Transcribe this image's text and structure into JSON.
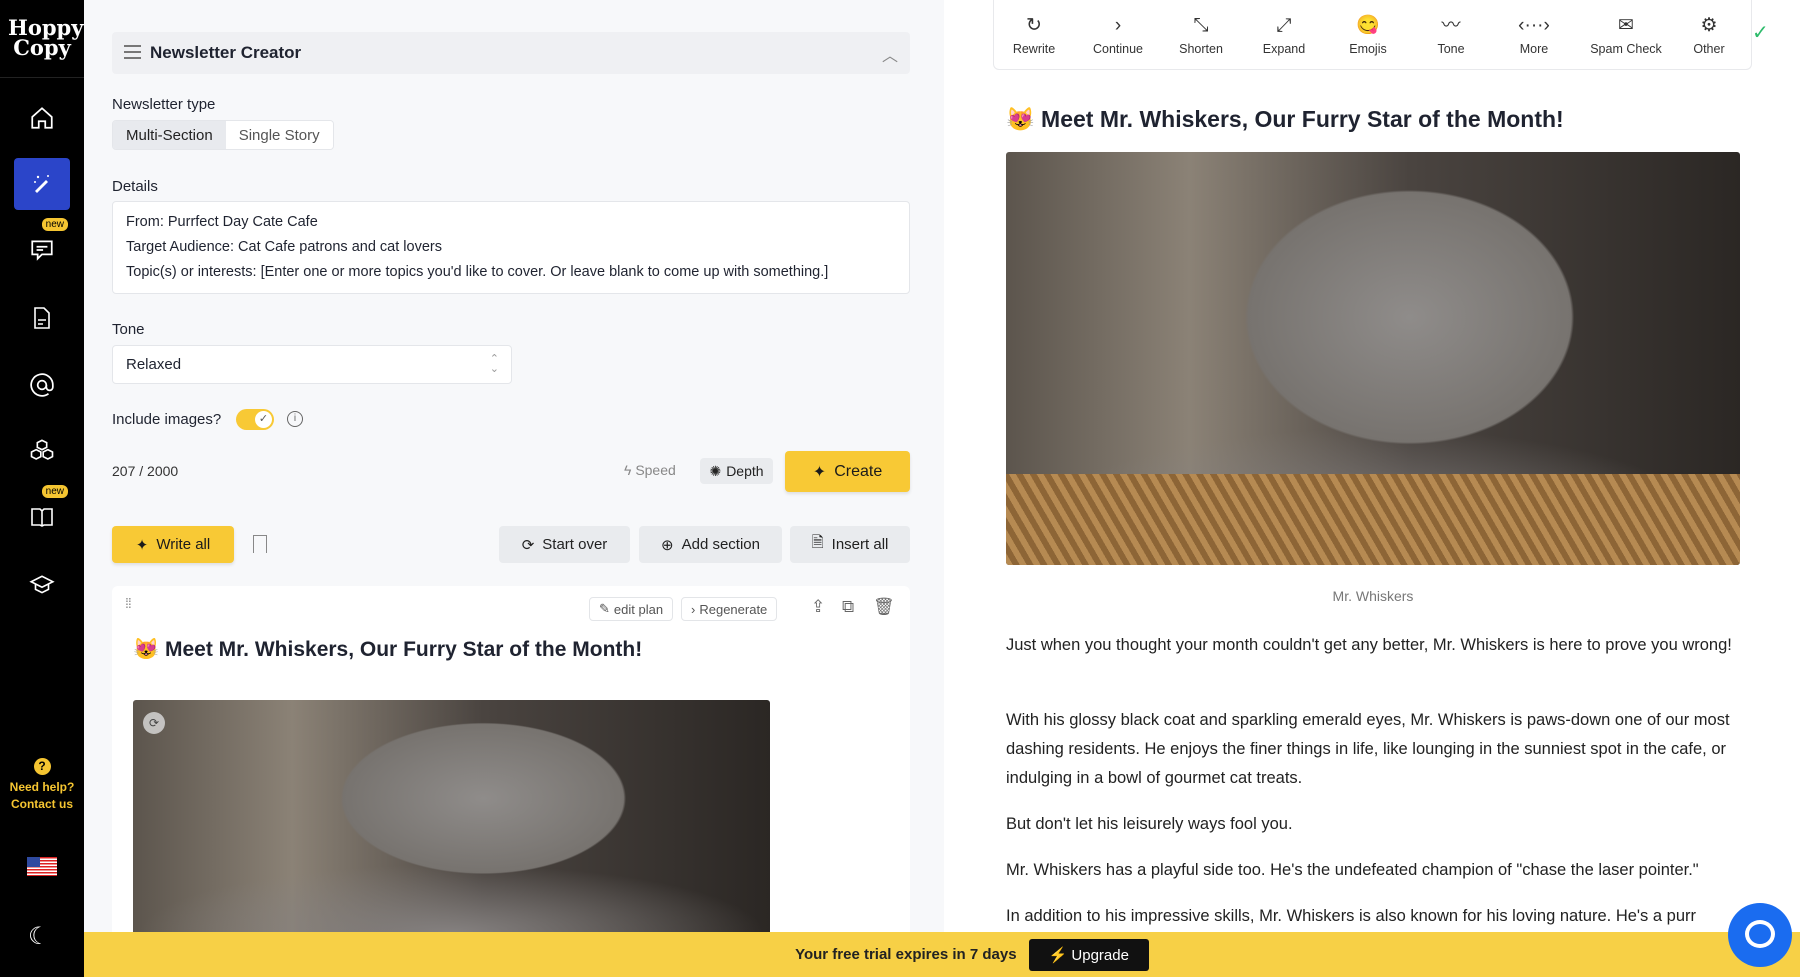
{
  "brand": {
    "logo_text": "Hoppy Copy"
  },
  "sidebar": {
    "items": [
      {
        "icon": "home-icon"
      },
      {
        "icon": "magic-wand-icon",
        "active": true
      },
      {
        "icon": "chat-icon",
        "badge": "new"
      },
      {
        "icon": "document-icon"
      },
      {
        "icon": "at-sign-icon"
      },
      {
        "icon": "cubes-icon"
      },
      {
        "icon": "book-icon",
        "badge": "new"
      },
      {
        "icon": "graduation-cap-icon"
      }
    ],
    "help_line1": "Need help?",
    "help_line2": "Contact us",
    "accent": "#2b45c9"
  },
  "panel": {
    "title": "Newsletter Creator",
    "newsletter_type_label": "Newsletter type",
    "types": [
      "Multi-Section",
      "Single Story"
    ],
    "selected_type": "Multi-Section",
    "details_label": "Details",
    "details_lines": [
      "From: Purrfect Day Cate Cafe",
      "Target Audience: Cat Cafe patrons and cat lovers",
      "Topic(s) or interests: [Enter one or more topics you'd like to cover. Or leave blank to come up with something.]"
    ],
    "tone_label": "Tone",
    "tone_value": "Relaxed",
    "include_images_label": "Include images?",
    "include_images": true,
    "char_count": "207 / 2000",
    "speed_label": "Speed",
    "depth_label": "Depth",
    "create_label": "Create",
    "write_all_label": "Write all",
    "start_over_label": "Start over",
    "add_section_label": "Add section",
    "insert_all_label": "Insert all"
  },
  "section_card": {
    "edit_plan_label": "edit plan",
    "regenerate_label": "Regenerate",
    "title_emoji": "😻",
    "title": "Meet Mr. Whiskers, Our Furry Star of the Month!"
  },
  "toolbar": {
    "items": [
      {
        "label": "Rewrite",
        "icon": "↻"
      },
      {
        "label": "Continue",
        "icon": "›"
      },
      {
        "label": "Shorten",
        "icon": "⤡"
      },
      {
        "label": "Expand",
        "icon": "⤢"
      },
      {
        "label": "Emojis",
        "icon": "😋"
      },
      {
        "label": "Tone",
        "icon": "〰"
      },
      {
        "label": "More",
        "icon": "‹···›"
      },
      {
        "label": "Spam Check",
        "icon": "✉"
      },
      {
        "label": "Other",
        "icon": "⚙"
      }
    ],
    "saved_icon": "✓"
  },
  "preview": {
    "title_emoji": "😻",
    "title": "Meet Mr. Whiskers, Our Furry Star of the Month!",
    "caption": "Mr. Whiskers",
    "paragraphs": [
      "Just when you thought your month couldn't get any better, Mr. Whiskers is here to prove you wrong!",
      "With his glossy black coat and sparkling emerald eyes, Mr. Whiskers is paws-down one of our most dashing residents. He enjoys the finer things in life, like lounging in the sunniest spot in the cafe, or indulging in a bowl of gourmet cat treats.",
      "But don't let his leisurely ways fool you.",
      "Mr. Whiskers has a playful side too. He's the undefeated champion of \"chase the laser pointer.\"",
      "In addition to his impressive skills, Mr. Whiskers is also known for his loving nature. He's a purr"
    ]
  },
  "trial_bar": {
    "text": "Your free trial expires in 7 days",
    "upgrade_label": "⚡ Upgrade",
    "color": "#f7d046"
  }
}
